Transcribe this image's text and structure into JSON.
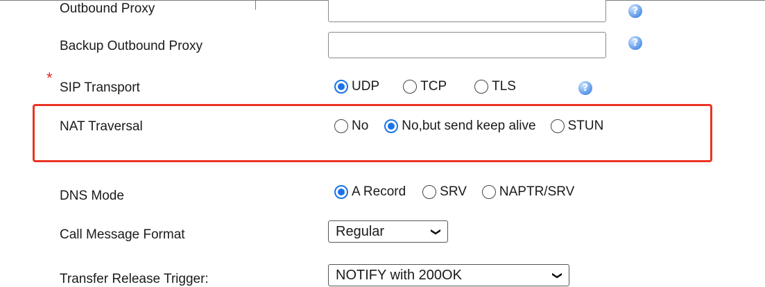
{
  "rows": {
    "outbound_proxy": {
      "label": "Outbound Proxy",
      "value": ""
    },
    "backup_outbound_proxy": {
      "label": "Backup Outbound Proxy",
      "value": ""
    },
    "sip_transport": {
      "required_mark": "*",
      "label": "SIP Transport",
      "options": [
        "UDP",
        "TCP",
        "TLS"
      ],
      "selected": "UDP"
    },
    "nat_traversal": {
      "label": "NAT Traversal",
      "options": [
        "No",
        "No,but send keep alive",
        "STUN"
      ],
      "selected": "No,but send keep alive"
    },
    "dns_mode": {
      "label": "DNS Mode",
      "options": [
        "A Record",
        "SRV",
        "NAPTR/SRV"
      ],
      "selected": "A Record"
    },
    "call_message_format": {
      "label": "Call Message Format",
      "value": "Regular"
    },
    "transfer_release_trigger": {
      "label": "Transfer Release Trigger:",
      "value": "NOTIFY with 200OK"
    }
  },
  "help_icon": "?",
  "colors": {
    "accent": "#1a73e8",
    "highlight_border": "#ea3323",
    "required_star": "#e32323"
  },
  "icons": {
    "help": "help-icon",
    "dropdown": "chevron-down-icon"
  }
}
